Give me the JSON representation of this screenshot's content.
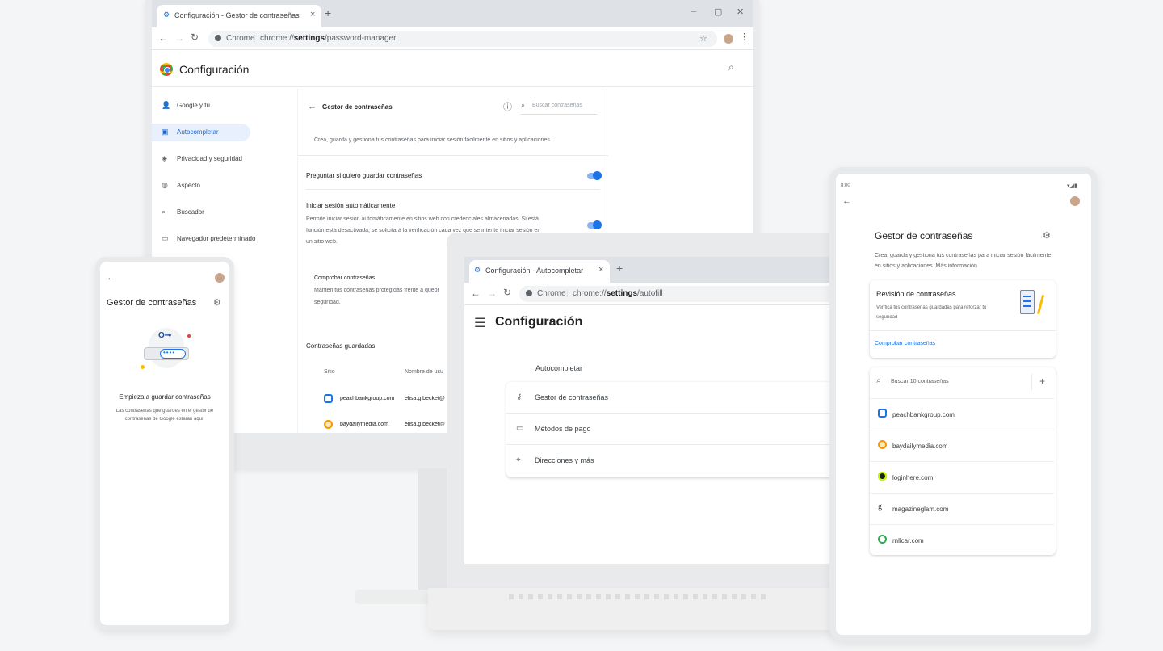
{
  "desktop": {
    "tab_title": "Configuración - Gestor de contraseñas",
    "tab_close": "×",
    "new_tab": "+",
    "window_controls": [
      "–",
      "▢",
      "✕"
    ],
    "url_prefix": "Chrome",
    "url_scheme": "chrome://",
    "url_bold": "settings",
    "url_path": "/password-manager",
    "app_title": "Configuración",
    "sidebar": [
      {
        "label": "Google y tú",
        "icon": "person-icon"
      },
      {
        "label": "Autocompletar",
        "icon": "autofill-icon"
      },
      {
        "label": "Privacidad y seguridad",
        "icon": "shield-icon"
      },
      {
        "label": "Aspecto",
        "icon": "palette-icon"
      },
      {
        "label": "Buscador",
        "icon": "search-icon"
      },
      {
        "label": "Navegador predeterminado",
        "icon": "browser-icon"
      }
    ],
    "panel_title": "Gestor de contraseñas",
    "search_placeholder": "Buscar contraseñas",
    "description": "Crea, guarda y gestiona tus contraseñas para iniciar sesión fácilmente en sitios y aplicaciones.",
    "offer_save_label": "Preguntar si quiero guardar contraseñas",
    "autosignin_title": "Iniciar sesión automáticamente",
    "autosignin_line1": "Permite iniciar sesión automáticamente en sitios web con credenciales almacenadas. Si está",
    "autosignin_line2": "función está desactivada, se solicitará la verificación cada vez que se intente iniciar sesión en",
    "autosignin_line3": "un sitio web.",
    "check_title": "Comprobar contraseñas",
    "check_line1": "Mantén tus contraseñas protegidas frente a quebr",
    "check_line2": "seguridad.",
    "saved_title": "Contraseñas guardadas",
    "col_site": "Sitio",
    "col_user": "Nombre de usu",
    "rows": [
      {
        "site": "peachbankgroup.com",
        "user": "elisa.g.becket@",
        "color": "#1a73e8"
      },
      {
        "site": "baydailymedia.com",
        "user": "elisa.g.becket@",
        "color": "#f29900"
      }
    ]
  },
  "laptop": {
    "tab_title": "Configuración - Autocompletar",
    "tab_close": "×",
    "new_tab": "+",
    "url_prefix": "Chrome",
    "url_scheme": "chrome://",
    "url_bold": "settings",
    "url_path": "/autofill",
    "app_title": "Configuración",
    "section_title": "Autocompletar",
    "items": [
      {
        "label": "Gestor de contraseñas",
        "icon": "key-icon"
      },
      {
        "label": "Métodos de pago",
        "icon": "card-icon"
      },
      {
        "label": "Direcciones y más",
        "icon": "location-icon"
      }
    ]
  },
  "phone": {
    "title": "Gestor de contraseñas",
    "empty_title": "Empieza a guardar contraseñas",
    "empty_line1": "Las contraseñas que guardes en el gestor de",
    "empty_line2": "contraseñas de Google estarán aquí."
  },
  "tablet": {
    "time": "8:00",
    "title": "Gestor de contraseñas",
    "desc_line1": "Crea, guarda y gestiona tus contraseñas para iniciar sesión fácilmente",
    "desc_line2": "en sitios y aplicaciones. Más información",
    "checkup_title": "Revisión de contraseñas",
    "checkup_line1": "Verifica tus contraseñas guardadas para reforzar tu",
    "checkup_line2": "seguridad",
    "checkup_link": "Comprobar contraseñas",
    "search_placeholder": "Buscar 10 contraseñas",
    "add": "+",
    "sites": [
      {
        "label": "peachbankgroup.com",
        "color": "#1a73e8"
      },
      {
        "label": "baydailymedia.com",
        "color": "#f29900"
      },
      {
        "label": "loginhere.com",
        "color": "#202124"
      },
      {
        "label": "magazineglam.com",
        "color": "#5f6368"
      },
      {
        "label": "rnllcar.com",
        "color": "#34a853"
      }
    ]
  }
}
